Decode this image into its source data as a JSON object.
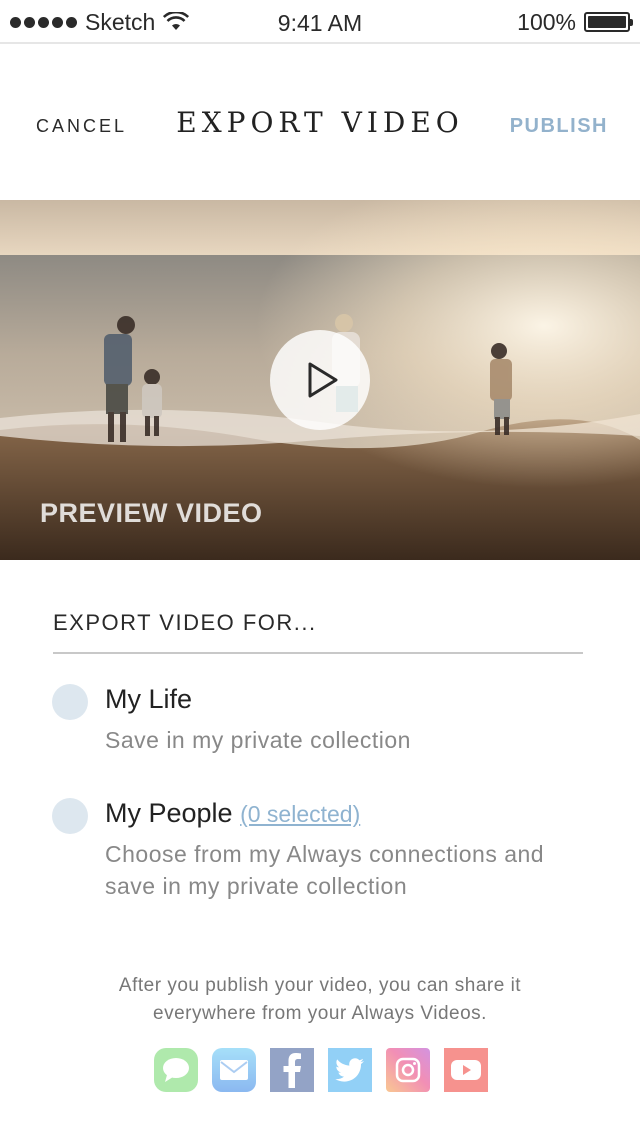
{
  "status_bar": {
    "carrier": "Sketch",
    "time": "9:41 AM",
    "battery": "100%"
  },
  "nav": {
    "cancel_label": "CANCEL",
    "title": "EXPORT VIDEO",
    "publish_label": "PUBLISH"
  },
  "preview": {
    "label": "PREVIEW VIDEO"
  },
  "export": {
    "section_title": "EXPORT VIDEO FOR...",
    "options": [
      {
        "title": "My Life",
        "description": "Save in my private collection",
        "selected": false
      },
      {
        "title": "My People",
        "link_text": "(0 selected)",
        "description": "Choose from my Always connections and save in my private collection",
        "selected": false
      }
    ]
  },
  "footer": {
    "line1": "After you publish your video, you can share it",
    "line2": "everywhere from your Always Videos."
  },
  "share_icons": [
    "messages-icon",
    "mail-icon",
    "facebook-icon",
    "twitter-icon",
    "instagram-icon",
    "youtube-icon"
  ],
  "colors": {
    "accent": "#93b2cc",
    "link": "#8fb3d0",
    "radio": "#dde7ef"
  }
}
